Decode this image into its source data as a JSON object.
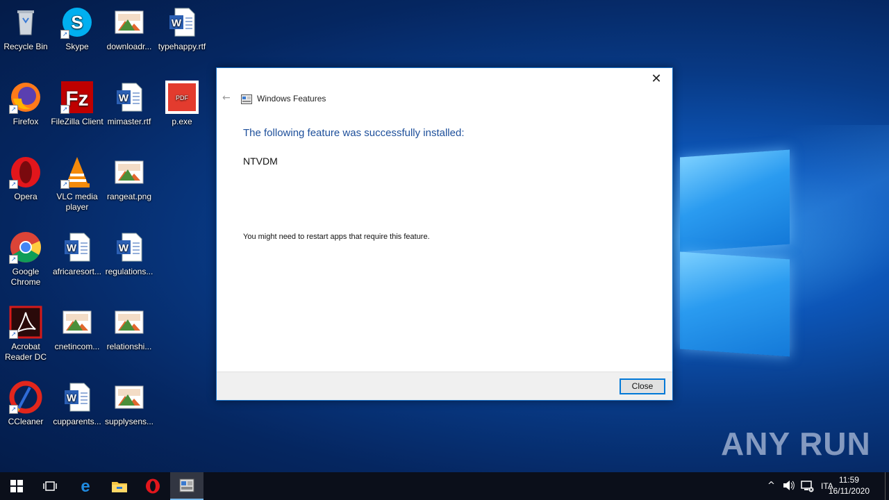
{
  "desktop": {
    "icons": [
      {
        "label": "Recycle Bin",
        "icon": "recycle-bin-icon"
      },
      {
        "label": "Skype",
        "icon": "skype-icon"
      },
      {
        "label": "downloadr...",
        "icon": "image-file-icon"
      },
      {
        "label": "typehappy.rtf",
        "icon": "word-document-icon"
      },
      {
        "label": "Firefox",
        "icon": "firefox-icon"
      },
      {
        "label": "FileZilla Client",
        "icon": "filezilla-icon"
      },
      {
        "label": "mimaster.rtf",
        "icon": "word-document-icon"
      },
      {
        "label": "p.exe",
        "icon": "pdf-icon"
      },
      {
        "label": "Opera",
        "icon": "opera-icon"
      },
      {
        "label": "VLC media player",
        "icon": "vlc-icon"
      },
      {
        "label": "rangeat.png",
        "icon": "image-file-icon"
      },
      {
        "label": "Google Chrome",
        "icon": "chrome-icon"
      },
      {
        "label": "africaresort...",
        "icon": "word-document-icon"
      },
      {
        "label": "regulations...",
        "icon": "word-document-icon"
      },
      {
        "label": "Acrobat Reader DC",
        "icon": "acrobat-icon"
      },
      {
        "label": "cnetincom...",
        "icon": "image-file-icon"
      },
      {
        "label": "relationshi...",
        "icon": "image-file-icon"
      },
      {
        "label": "CCleaner",
        "icon": "ccleaner-icon"
      },
      {
        "label": "cupparents...",
        "icon": "word-document-icon"
      },
      {
        "label": "supplysens...",
        "icon": "image-file-icon"
      }
    ],
    "pdf_badge": "PDF"
  },
  "dialog": {
    "title": "Windows Features",
    "heading": "The following feature was successfully installed:",
    "feature_name": "NTVDM",
    "note": "You might need to restart apps that require this feature.",
    "close_button": "Close",
    "close_glyph": "✕",
    "back_glyph": "←"
  },
  "taskbar": {
    "language": "ITA",
    "time": "11:59",
    "date": "16/11/2020"
  },
  "watermark": "ANY RUN",
  "colors": {
    "dialog_heading": "#1c4e9a",
    "accent": "#0078d7"
  }
}
